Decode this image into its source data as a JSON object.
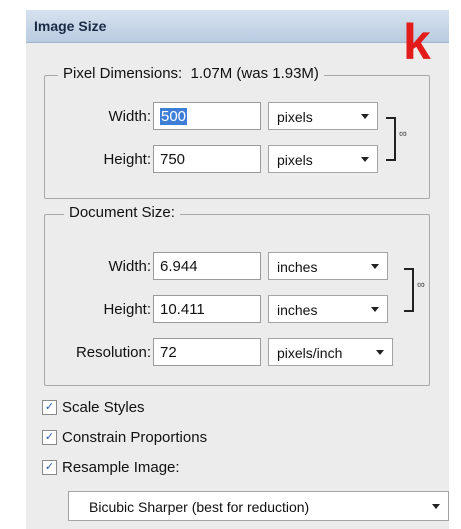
{
  "dialog": {
    "title": "Image Size",
    "annotation_letter": "k"
  },
  "pixel_dimensions": {
    "legend": "Pixel Dimensions:  1.07M (was 1.93M)",
    "width_label": "Width:",
    "width_value": "500",
    "width_unit": "pixels",
    "height_label": "Height:",
    "height_value": "750",
    "height_unit": "pixels",
    "link_icon": "chain-link-icon"
  },
  "document_size": {
    "legend": "Document Size:",
    "width_label": "Width:",
    "width_value": "6.944",
    "width_unit": "inches",
    "height_label": "Height:",
    "height_value": "10.411",
    "height_unit": "inches",
    "resolution_label": "Resolution:",
    "resolution_value": "72",
    "resolution_unit": "pixels/inch",
    "link_icon": "chain-link-icon"
  },
  "options": {
    "scale_styles": {
      "label": "Scale Styles",
      "checked": true
    },
    "constrain_proportions": {
      "label": "Constrain Proportions",
      "checked": true
    },
    "resample_image": {
      "label": "Resample Image:",
      "checked": true
    },
    "resample_method": "Bicubic Sharper (best for reduction)"
  },
  "colors": {
    "selection": "#3d7fd6",
    "annotation": "#e31b1b",
    "titlebar": "#c8d7e8"
  }
}
